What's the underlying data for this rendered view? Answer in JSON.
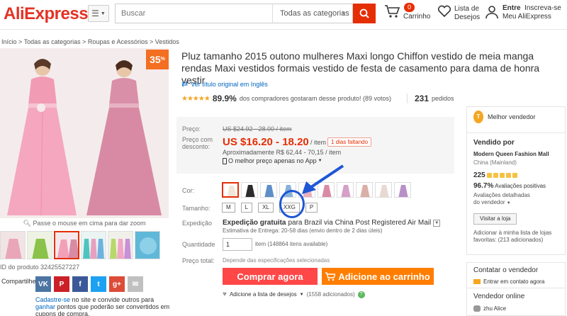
{
  "header": {
    "logo": "AliExpress",
    "search_placeholder": "Buscar",
    "search_category": "Todas as categorias",
    "cart_count": "0",
    "cart_label": "Carrinho",
    "wishlist_line1": "Lista de",
    "wishlist_line2": "Desejos",
    "user_line1_bold": "Entre",
    "user_line1_rest": "Inscreva-se",
    "user_line2": "Meu AliExpress"
  },
  "breadcrumb": "Início > Todas as categorias > Roupas e Acessórios > Vestidos",
  "gallery": {
    "discount_value": "35",
    "discount_pct": "%",
    "discount_off": "OFF",
    "zoom_hint": "Passe o mouse em cima para dar zoom",
    "product_id": "ID do produto 32425527227",
    "share_label": "Compartilhe:",
    "share_icons": [
      "VK",
      "P",
      "f",
      "t",
      "g+",
      "✉"
    ],
    "promo_link1": "Cadastre-se",
    "promo_text1": " no site e convide outros para ",
    "promo_link2": "ganhar",
    "promo_text2": " pontos que poderão ser convertidos em cupons de compra."
  },
  "product": {
    "title": "Pluz tamanho 2015 outono mulheres Maxi longo Chiffon vestido de meia manga rendas Maxi vestidos formais vestido de festa de casamento para dama de honra vestir",
    "translate_link": "Ver título original em Inglês",
    "rating_pct": "89.9%",
    "rating_text": "dos compradores gostaram desse produto! (89 votos)",
    "orders_count": "231",
    "orders_label": "pedidos"
  },
  "price": {
    "label_price": "Preço:",
    "old_price": "US $24.92 - 28.00 / item",
    "label_discount_line1": "Preço com",
    "label_discount_line2": "desconto:",
    "new_price": "US $16.20 - 18.20",
    "per_item": "/ item",
    "days_left": "1 dias faltando",
    "approx": "Aproximadamente R$ 62,44 - 70,15 / item",
    "app_price": "O melhor preço apenas no App"
  },
  "options": {
    "color_label": "Cor:",
    "size_label": "Tamanho:",
    "sizes": [
      "M",
      "L",
      "XL",
      "XXG",
      "P"
    ],
    "swatch_colors": [
      "#efe6d8",
      "#2c2c2c",
      "#5e8fc8",
      "#8ab2d8",
      "#e9b0bc",
      "#d98ba4",
      "#d6a0c8",
      "#d8b0a6",
      "#e8dad2",
      "#b890c8"
    ]
  },
  "shipping": {
    "label": "Expedição",
    "main_bold": "Expedição gratuita",
    "main_rest": "para Brazil via China Post Registered Air Mail",
    "sub": "Estimativa de Entrega: 20-58 dias (envio dentro de 2 dias úteis)"
  },
  "quantity": {
    "label": "Quantidade",
    "value": "1",
    "available": "item (148864 itens available)"
  },
  "total": {
    "label": "Preço total:",
    "text": "Depende das especificações selecionadas"
  },
  "actions": {
    "buy_now": "Comprar agora",
    "add_cart": "Adicione ao carrinho",
    "wishlist": "Adicione a lista de desejos",
    "wishlist_count": "(1558 adicionados)"
  },
  "seller": {
    "badge": "Melhor vendedor",
    "sold_by": "Vendido por",
    "store_name": "Modern Queen Fashion Mall",
    "store_country": "China (Mainland)",
    "score": "225",
    "positive_pct": "96.7%",
    "positive_label": "Avaliações positivas",
    "detail_link": "Avaliações detalhadas do vendedor",
    "visit_store": "Visitar a loja",
    "fav_line": "Adicionar à minha lista de lojas favoritas: (213 adicionados)",
    "contact_head": "Contatar o vendedor",
    "contact_link": "Entrar em contato agora",
    "online_head": "Vendedor online",
    "online_user": "zhu Alice"
  },
  "colors": {
    "brand_red": "#e62e04",
    "buy_button": "#ff4747",
    "cart_button": "#ff7e00",
    "link_blue": "#0066c0",
    "annotation_blue": "#1f56d6"
  }
}
